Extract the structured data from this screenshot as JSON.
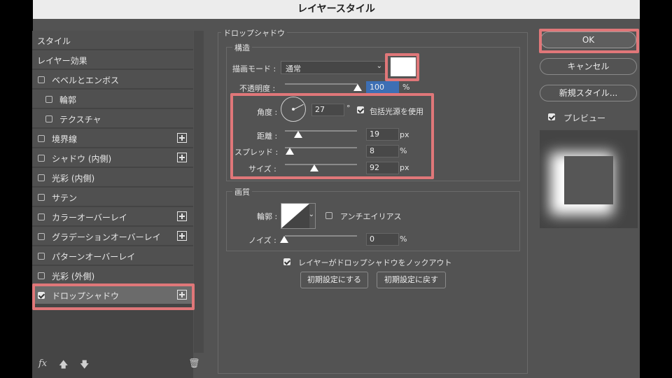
{
  "window": {
    "title": "レイヤースタイル"
  },
  "sidebar": {
    "style_header": "スタイル",
    "effects_header": "レイヤー効果",
    "items": [
      {
        "label": "ベベルとエンボス",
        "checked": false
      },
      {
        "label": "輪郭",
        "checked": false
      },
      {
        "label": "テクスチャ",
        "checked": false
      },
      {
        "label": "境界線",
        "checked": false
      },
      {
        "label": "シャドウ (内側)",
        "checked": false
      },
      {
        "label": "光彩 (内側)",
        "checked": false
      },
      {
        "label": "サテン",
        "checked": false
      },
      {
        "label": "カラーオーバーレイ",
        "checked": false
      },
      {
        "label": "グラデーションオーバーレイ",
        "checked": false
      },
      {
        "label": "パターンオーバーレイ",
        "checked": false
      },
      {
        "label": "光彩 (外側)",
        "checked": false
      },
      {
        "label": "ドロップシャドウ",
        "checked": true
      }
    ],
    "fx_label": "fx"
  },
  "drop_shadow": {
    "section_title": "ドロップシャドウ",
    "structure_title": "構造",
    "blend_mode_label": "描画モード :",
    "blend_mode_value": "通常",
    "opacity_label": "不透明度 :",
    "opacity_value": "100",
    "opacity_unit": "%",
    "angle_label": "角度 :",
    "angle_value": "27",
    "angle_unit": "°",
    "global_light_label": "包括光源を使用",
    "distance_label": "距離 :",
    "distance_value": "19",
    "distance_unit": "px",
    "spread_label": "スプレッド :",
    "spread_value": "8",
    "spread_unit": "%",
    "size_label": "サイズ :",
    "size_value": "92",
    "size_unit": "px",
    "quality_title": "画質",
    "contour_label": "輪郭 :",
    "antialias_label": "アンチエイリアス",
    "noise_label": "ノイズ :",
    "noise_value": "0",
    "noise_unit": "%",
    "knockout_label": "レイヤーがドロップシャドウをノックアウト",
    "make_default_label": "初期設定にする",
    "reset_default_label": "初期設定に戻す"
  },
  "actions": {
    "ok_label": "OK",
    "cancel_label": "キャンセル",
    "new_style_label": "新規スタイル...",
    "preview_label": "プレビュー"
  },
  "colors": {
    "highlight": "#e07779",
    "shadow_color": "#ffffff"
  }
}
